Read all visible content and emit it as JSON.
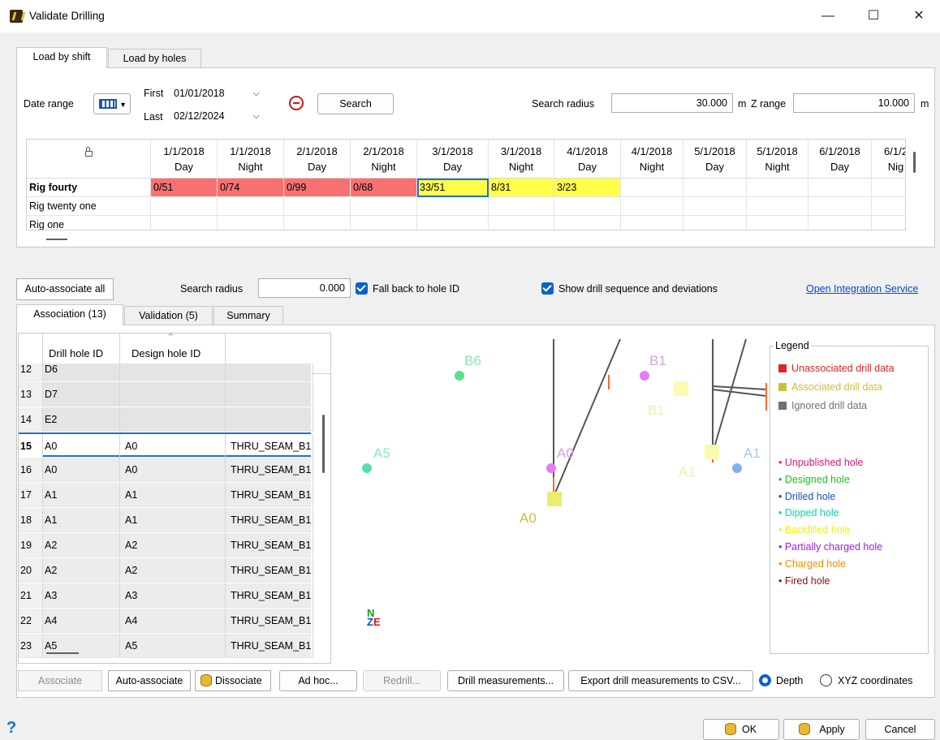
{
  "window": {
    "title": "Validate Drilling",
    "minimize": "—",
    "maximize": "☐",
    "close": "✕"
  },
  "top_tabs": [
    {
      "label": "Load by shift",
      "active": true
    },
    {
      "label": "Load by holes",
      "active": false
    }
  ],
  "filters": {
    "date_range_label": "Date range",
    "first_label": "First",
    "first_value": "01/01/2018",
    "last_label": "Last",
    "last_value": "02/12/2024",
    "search_label": "Search",
    "search_radius_label": "Search radius",
    "search_radius_value": "30.000",
    "search_radius_unit": "m",
    "z_range_label": "Z range",
    "z_range_value": "10.000",
    "z_range_unit": "m"
  },
  "shift_grid": {
    "columns": [
      {
        "date": "1/1/2018",
        "shift": "Day"
      },
      {
        "date": "1/1/2018",
        "shift": "Night"
      },
      {
        "date": "2/1/2018",
        "shift": "Day"
      },
      {
        "date": "2/1/2018",
        "shift": "Night"
      },
      {
        "date": "3/1/2018",
        "shift": "Day"
      },
      {
        "date": "3/1/2018",
        "shift": "Night"
      },
      {
        "date": "4/1/2018",
        "shift": "Day"
      },
      {
        "date": "4/1/2018",
        "shift": "Night"
      },
      {
        "date": "5/1/2018",
        "shift": "Day"
      },
      {
        "date": "5/1/2018",
        "shift": "Night"
      },
      {
        "date": "6/1/2018",
        "shift": "Day"
      },
      {
        "date": "6/1/2",
        "shift": "Nig"
      }
    ],
    "rows": [
      {
        "rig": "Rig fourty",
        "cells": [
          "0/51",
          "0/74",
          "0/99",
          "0/68",
          "33/51",
          "8/31",
          "3/23",
          "",
          "",
          "",
          "",
          ""
        ]
      },
      {
        "rig": "Rig twenty one",
        "cells": [
          "",
          "",
          "",
          "",
          "",
          "",
          "",
          "",
          "",
          "",
          "",
          ""
        ]
      },
      {
        "rig": "Rig one",
        "cells": [
          "",
          "",
          "",
          "",
          "",
          "",
          "",
          "",
          "",
          "",
          "",
          ""
        ]
      }
    ]
  },
  "assoc_controls": {
    "auto_associate_all": "Auto-associate all",
    "search_radius_label": "Search radius",
    "search_radius_value": "0.000",
    "fallback_label": "Fall back to hole ID",
    "show_sequence_label": "Show drill sequence and deviations",
    "open_integration_link": "Open Integration Service"
  },
  "lower_tabs": [
    {
      "label": "Association (13)",
      "active": true
    },
    {
      "label": "Validation (5)",
      "active": false
    },
    {
      "label": "Summary",
      "active": false
    }
  ],
  "assoc_table": {
    "headers": [
      "Drill hole ID",
      "Design hole ID",
      ""
    ],
    "rows": [
      {
        "n": "12",
        "drill": "D6",
        "design": "",
        "seam": ""
      },
      {
        "n": "13",
        "drill": "D7",
        "design": "",
        "seam": ""
      },
      {
        "n": "14",
        "drill": "E2",
        "design": "",
        "seam": ""
      },
      {
        "n": "15",
        "drill": "A0",
        "design": "A0",
        "seam": "THRU_SEAM_B1"
      },
      {
        "n": "16",
        "drill": "A0",
        "design": "A0",
        "seam": "THRU_SEAM_B1"
      },
      {
        "n": "17",
        "drill": "A1",
        "design": "A1",
        "seam": "THRU_SEAM_B1"
      },
      {
        "n": "18",
        "drill": "A1",
        "design": "A1",
        "seam": "THRU_SEAM_B1"
      },
      {
        "n": "19",
        "drill": "A2",
        "design": "A2",
        "seam": "THRU_SEAM_B1"
      },
      {
        "n": "20",
        "drill": "A2",
        "design": "A2",
        "seam": "THRU_SEAM_B1"
      },
      {
        "n": "21",
        "drill": "A3",
        "design": "A3",
        "seam": "THRU_SEAM_B1"
      },
      {
        "n": "22",
        "drill": "A4",
        "design": "A4",
        "seam": "THRU_SEAM_B1"
      },
      {
        "n": "23",
        "drill": "A5",
        "design": "A5",
        "seam": "THRU_SEAM_B1"
      }
    ]
  },
  "canvas": {
    "labels": {
      "b6": "B6",
      "b1_top": "B1",
      "b1_low": "B1",
      "a5": "A5",
      "a0_mid": "A0",
      "a0_low": "A0",
      "a1_left": "A1",
      "a1_right": "A1"
    },
    "compass": {
      "n": "N",
      "z": "Z",
      "e": "E"
    },
    "legend": {
      "title": "Legend",
      "data_items": [
        {
          "label": "Unassociated drill data",
          "color": "#e02424"
        },
        {
          "label": "Associated drill data",
          "color": "#c8c03c"
        },
        {
          "label": "Ignored drill data",
          "color": "#707070"
        }
      ],
      "hole_items": [
        {
          "label": "• Unpublished hole",
          "color": "#e0187a"
        },
        {
          "label": "• Designed hole",
          "color": "#16c41c"
        },
        {
          "label": "• Drilled hole",
          "color": "#1852c8"
        },
        {
          "label": "• Dipped hole",
          "color": "#12d0a0"
        },
        {
          "label": "• Backfilled hole",
          "color": "#f4f000"
        },
        {
          "label": "• Partially charged hole",
          "color": "#a020e0"
        },
        {
          "label": "• Charged hole",
          "color": "#f09000"
        },
        {
          "label": "• Fired hole",
          "color": "#8a1010"
        }
      ]
    }
  },
  "bottom_buttons": {
    "associate": "Associate",
    "auto_associate": "Auto-associate",
    "dissociate": "Dissociate",
    "ad_hoc": "Ad hoc...",
    "redrill": "Redrill...",
    "drill_measurements": "Drill measurements...",
    "export_csv": "Export drill measurements to CSV...",
    "depth": "Depth",
    "xyz": "XYZ coordinates"
  },
  "footer": {
    "help": "?",
    "ok": "OK",
    "apply": "Apply",
    "cancel": "Cancel"
  }
}
